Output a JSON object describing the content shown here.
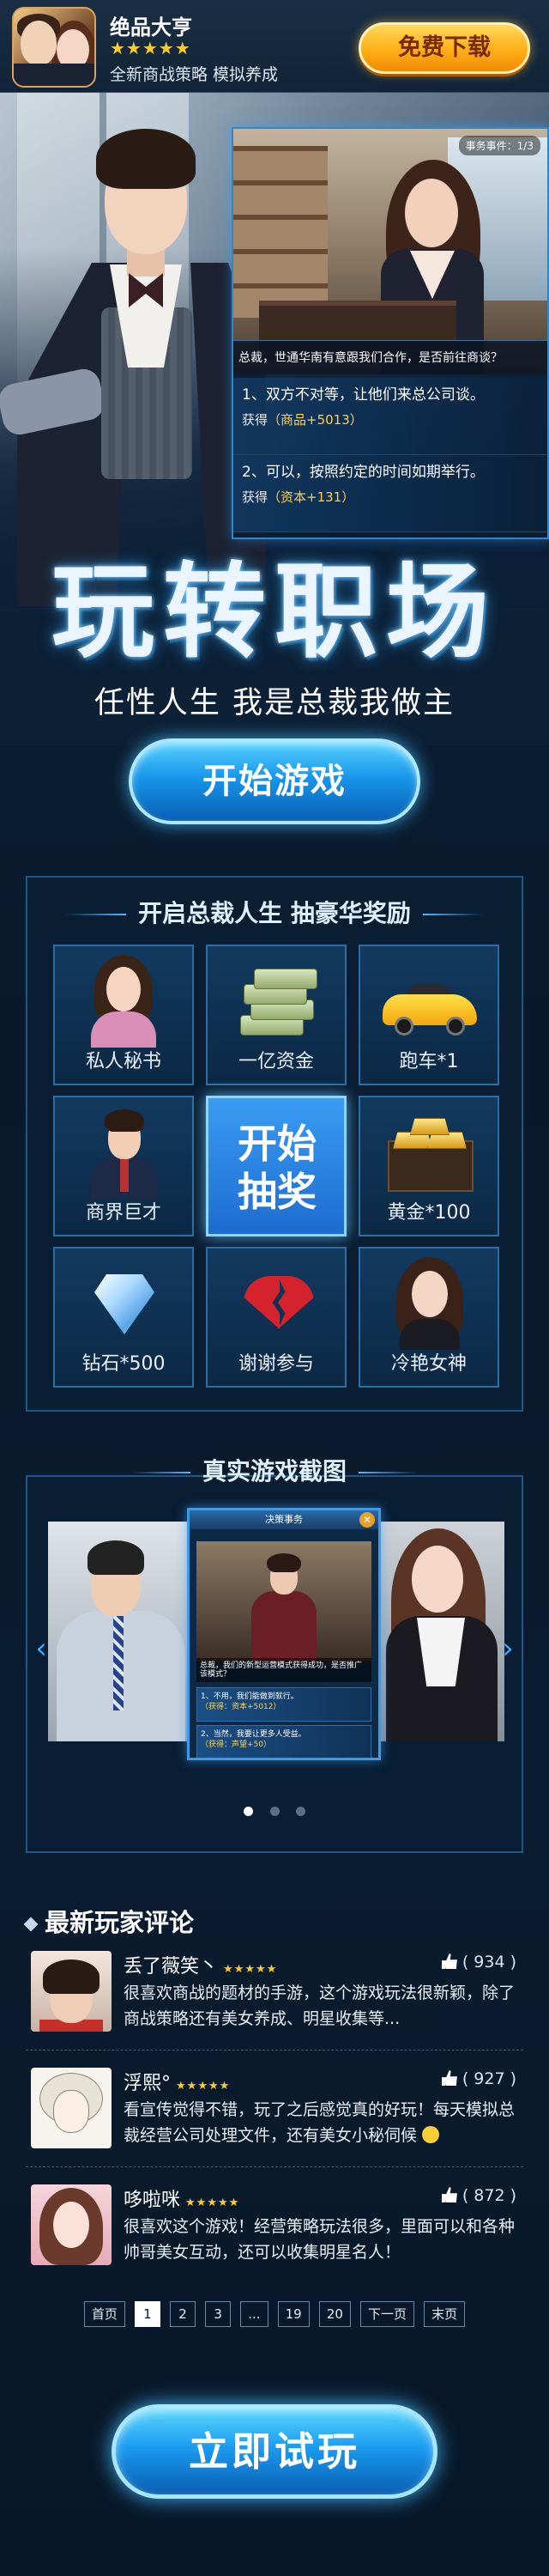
{
  "app": {
    "title": "绝品大亨",
    "stars": "★★★★★",
    "desc": "全新商战策略 模拟养成",
    "download_label": "免费下载"
  },
  "hero": {
    "quest_tag": "事务事件：1/3",
    "dialog": "总裁，世通华南有意跟我们合作，是否前往商谈？",
    "options": [
      {
        "text": "1、双方不对等，让他们来总公司谈。",
        "reward_prefix": "获得",
        "reward": "（商品+5013）"
      },
      {
        "text": "2、可以，按照约定的时间如期举行。",
        "reward_prefix": "获得",
        "reward": "（资本+131）"
      }
    ],
    "title": "玩转职场",
    "subtitle": "任性人生 我是总裁我做主",
    "start_label": "开始游戏"
  },
  "lottery": {
    "title": "开启总裁人生 抽豪华奖励",
    "center_line1": "开始",
    "center_line2": "抽奖",
    "prizes": [
      {
        "label": "私人秘书",
        "icon": "secretary-icon"
      },
      {
        "label": "一亿资金",
        "icon": "money-icon"
      },
      {
        "label": "跑车*1",
        "icon": "sports-car-icon"
      },
      {
        "label": "商界巨才",
        "icon": "businessman-icon"
      },
      {
        "label": "黄金*100",
        "icon": "gold-icon"
      },
      {
        "label": "钻石*500",
        "icon": "diamond-icon"
      },
      {
        "label": "谢谢参与",
        "icon": "broken-heart-icon"
      },
      {
        "label": "冷艳女神",
        "icon": "goddess-icon"
      }
    ]
  },
  "screenshots": {
    "title": "真实游戏截图",
    "center_header": "决策事务",
    "center_close": "✕",
    "center_dialog": "总裁，我们的新型运营模式获得成功，是否推广该模式？",
    "center_options": [
      {
        "text": "1、不用，我们能做到就行。",
        "reward": "（获得：资本+5012）"
      },
      {
        "text": "2、当然，我要让更多人受益。",
        "reward": "（获得：声望+50）"
      }
    ],
    "active_index": 0
  },
  "comments": {
    "title": "最新玩家评论",
    "items": [
      {
        "name": "丢了薇笑丶",
        "stars": "★★★★★",
        "likes": "( 934 )",
        "text": "很喜欢商战的题材的手游，这个游戏玩法很新颖，除了商战策略还有美女养成、明星收集等..."
      },
      {
        "name": "浮熙°",
        "stars": "★★★★★",
        "likes": "( 927 )",
        "text": "看宣传觉得不错，玩了之后感觉真的好玩！每天模拟总裁经营公司处理文件，还有美女小秘伺候"
      },
      {
        "name": "哆啦咪",
        "stars": "★★★★★",
        "likes": "( 872 )",
        "text": "很喜欢这个游戏！经营策略玩法很多，里面可以和各种帅哥美女互动，还可以收集明星名人！"
      }
    ]
  },
  "pager": {
    "first": "首页",
    "pages": [
      "1",
      "2",
      "3",
      "...",
      "19",
      "20"
    ],
    "next": "下一页",
    "last": "末页",
    "current": "1"
  },
  "cta": {
    "label": "立即试玩"
  }
}
